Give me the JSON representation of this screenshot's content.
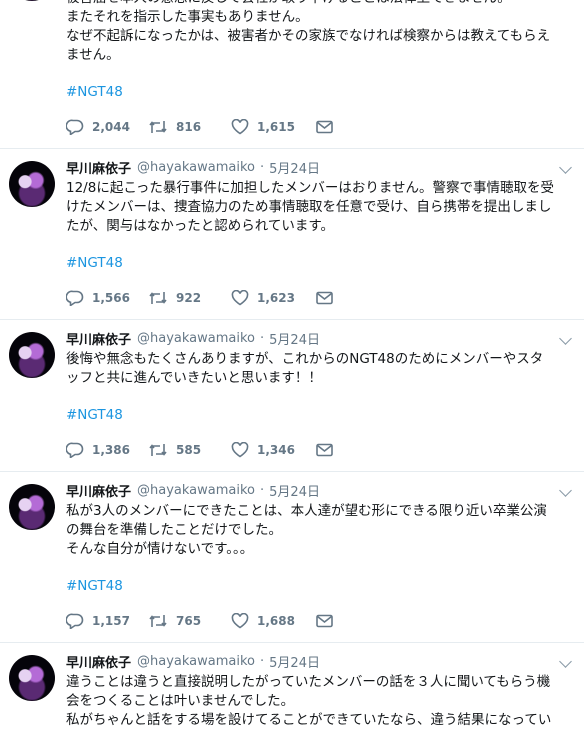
{
  "tweets": [
    {
      "partial": true,
      "lines": [
        "被害届を本人の意思に反して会社が取り下げることは法律上できません。",
        "またそれを指示した事実もありません。",
        "なぜ不起訴になったかは、被害者かその家族でなければ検察からは教えてもらえ",
        "ません。"
      ],
      "hashtag": "#NGT48",
      "replies": "2,044",
      "retweets": "816",
      "likes": "1,615"
    },
    {
      "name": "早川麻依子",
      "handle": "@hayakawamaiko",
      "time": "5月24日",
      "lines": [
        "12/8に起こった暴行事件に加担したメンバーはおりません。警察で事情聴取を受",
        "けたメンバーは、捜査協力のため事情聴取を任意で受け、自ら携帯を提出しまし",
        "たが、関与はなかったと認められています。"
      ],
      "hashtag": "#NGT48",
      "replies": "1,566",
      "retweets": "922",
      "likes": "1,623"
    },
    {
      "name": "早川麻依子",
      "handle": "@hayakawamaiko",
      "time": "5月24日",
      "lines": [
        "後悔や無念もたくさんありますが、これからのNGT48のためにメンバーやスタ",
        "ッフと共に進んでいきたいと思います！！"
      ],
      "hashtag": "#NGT48",
      "replies": "1,386",
      "retweets": "585",
      "likes": "1,346"
    },
    {
      "name": "早川麻依子",
      "handle": "@hayakawamaiko",
      "time": "5月24日",
      "lines": [
        "私が3人のメンバーにできたことは、本人達が望む形にできる限り近い卒業公演",
        "の舞台を準備したことだけでした。",
        "そんな自分が情けないです。。。"
      ],
      "hashtag": "#NGT48",
      "replies": "1,157",
      "retweets": "765",
      "likes": "1,688"
    },
    {
      "name": "早川麻依子",
      "handle": "@hayakawamaiko",
      "time": "5月24日",
      "lines": [
        "違うことは違うと直接説明したがっていたメンバーの話を３人に聞いてもらう機",
        "会をつくることは叶いませんでした。",
        "私がちゃんと話をする場を設けてることができていたなら、違う結果になってい"
      ]
    }
  ]
}
